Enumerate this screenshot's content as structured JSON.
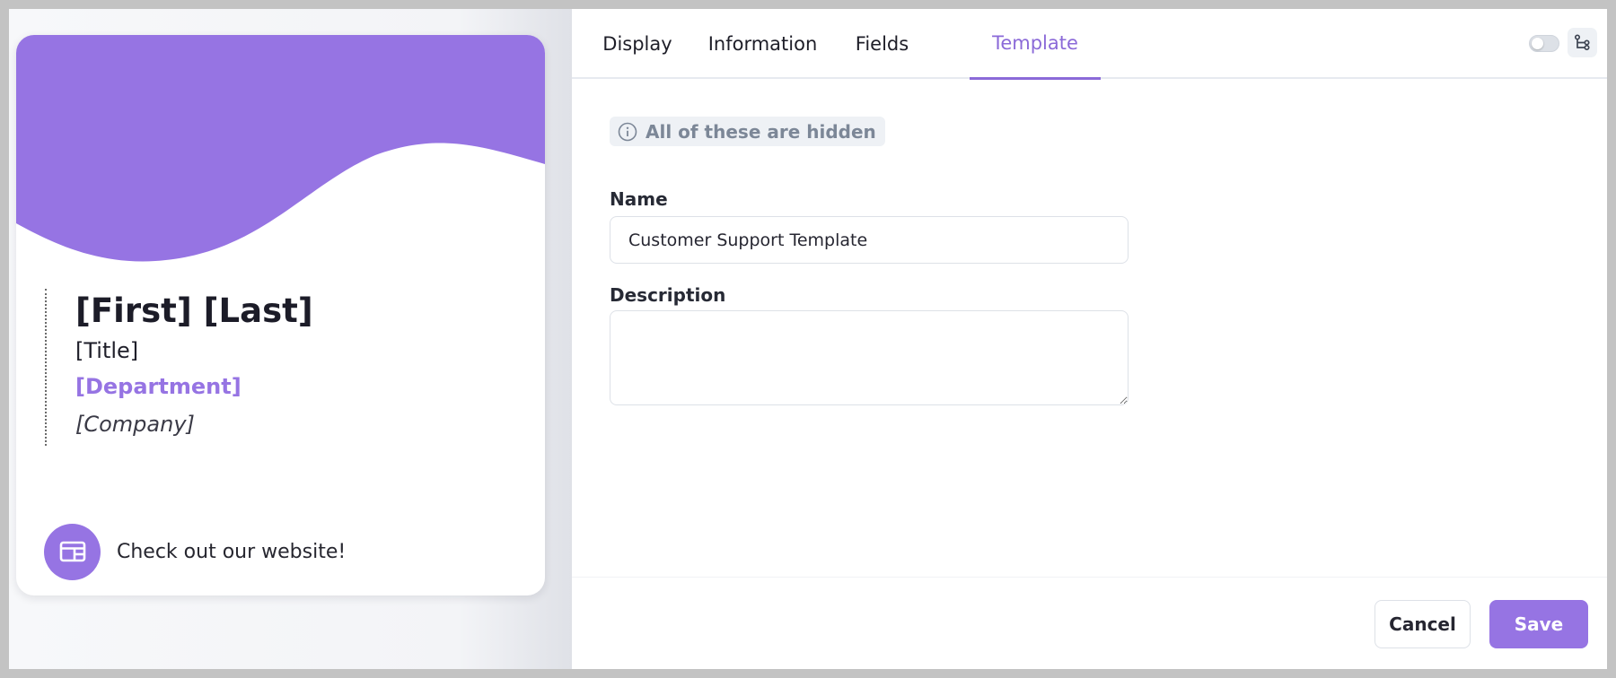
{
  "colors": {
    "accent": "#9674e3",
    "tab_active": "#8b6ad8",
    "badge_bg": "#eef1f5",
    "badge_text": "#7c8797"
  },
  "preview": {
    "card": {
      "name": "[First] [Last]",
      "title": "[Title]",
      "department": "[Department]",
      "company": "[Company]",
      "website_icon": "browser-window-icon",
      "website_text": "Check out our website!"
    }
  },
  "tabs": [
    {
      "label": "Display",
      "active": false
    },
    {
      "label": "Information",
      "active": false
    },
    {
      "label": "Fields",
      "active": false
    },
    {
      "label": "Template",
      "active": true
    }
  ],
  "toolbar": {
    "toggle_on": false,
    "toggle_icon": "toggle-switch-icon",
    "tree_icon": "hierarchy-tree-icon"
  },
  "template_form": {
    "hidden_notice": {
      "icon": "info-circle-icon",
      "text": "All of these are hidden"
    },
    "name_label": "Name",
    "name_value": "Customer Support Template",
    "description_label": "Description",
    "description_value": ""
  },
  "footer": {
    "cancel_label": "Cancel",
    "save_label": "Save"
  }
}
